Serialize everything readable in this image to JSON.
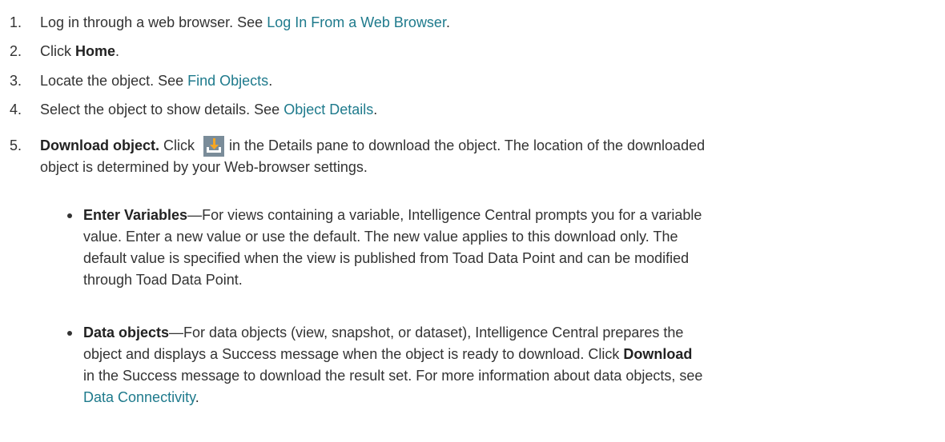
{
  "steps": [
    {
      "num": "1.",
      "text_before": "Log in through a web browser. See ",
      "link": "Log In From a Web Browser",
      "text_after": "."
    },
    {
      "num": "2.",
      "text_before": "Click ",
      "bold": "Home",
      "text_after": "."
    },
    {
      "num": "3.",
      "text_before": "Locate the object. See ",
      "link": "Find Objects",
      "text_after": "."
    },
    {
      "num": "4.",
      "text_before": "Select the object to show details. See ",
      "link": "Object Details",
      "text_after": "."
    }
  ],
  "step5": {
    "num": "5.",
    "bold": "Download object.",
    "click": " Click ",
    "icon": "download-icon",
    "after_icon": " in the Details pane to download the object. The location of the downloaded",
    "continuation": "object is determined by your Web-browser settings."
  },
  "bullets": [
    {
      "bold": "Enter Variables",
      "lines": [
        "—For views containing a variable, Intelligence Central prompts you for a variable",
        "value. Enter a new value or use the default. The new value applies to this download only. The",
        "default value is specified when the view is published from Toad Data Point and can be modified",
        "through Toad Data Point."
      ]
    },
    {
      "bold": "Data objects",
      "line1": "—For data objects (view, snapshot, or dataset), Intelligence Central prepares the",
      "line2": "object and displays a Success message when the object is ready to download. Click ",
      "line2_bold": "Download",
      "line3": "in the Success message to download the result set. For more information about data objects, see",
      "link": "Data Connectivity",
      "link_after": "."
    }
  ],
  "colors": {
    "link": "#1e7a8c",
    "text": "#333333",
    "icon_bg": "#7a8c99"
  }
}
